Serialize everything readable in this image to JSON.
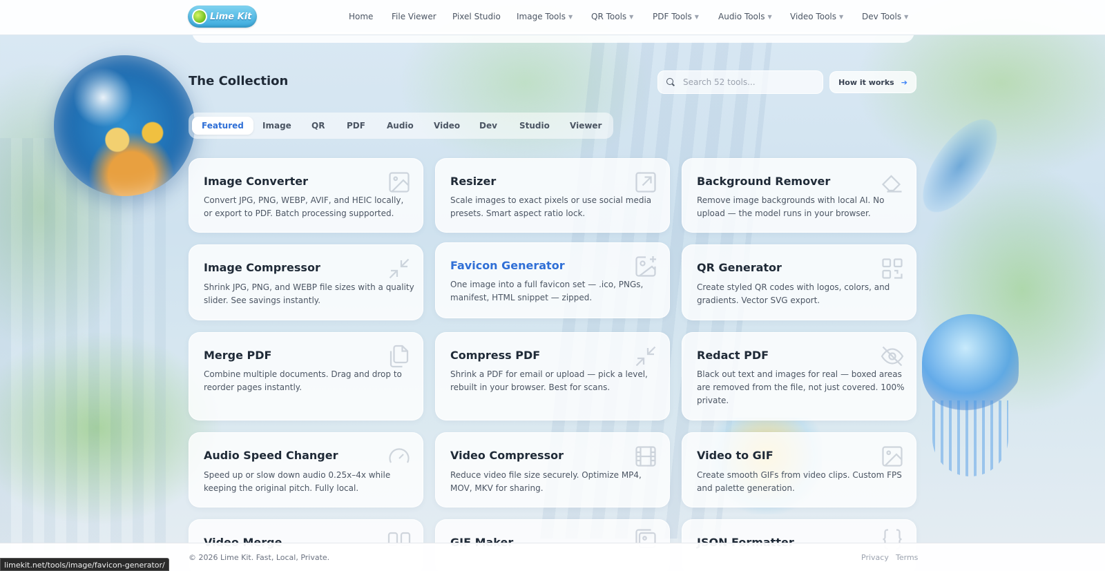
{
  "brand": {
    "logo_text": "Lime Kit"
  },
  "nav": {
    "items": [
      {
        "label": "Home",
        "dropdown": false
      },
      {
        "label": "File Viewer",
        "dropdown": false
      },
      {
        "label": "Pixel Studio",
        "dropdown": false
      },
      {
        "label": "Image Tools",
        "dropdown": true
      },
      {
        "label": "QR Tools",
        "dropdown": true
      },
      {
        "label": "PDF Tools",
        "dropdown": true
      },
      {
        "label": "Audio Tools",
        "dropdown": true
      },
      {
        "label": "Video Tools",
        "dropdown": true
      },
      {
        "label": "Dev Tools",
        "dropdown": true
      }
    ]
  },
  "collection": {
    "title": "The Collection",
    "search_placeholder": "Search 52 tools...",
    "how_label": "How it works"
  },
  "tabs": [
    {
      "label": "Featured",
      "active": true
    },
    {
      "label": "Image",
      "active": false
    },
    {
      "label": "QR",
      "active": false
    },
    {
      "label": "PDF",
      "active": false
    },
    {
      "label": "Audio",
      "active": false
    },
    {
      "label": "Video",
      "active": false
    },
    {
      "label": "Dev",
      "active": false
    },
    {
      "label": "Studio",
      "active": false
    },
    {
      "label": "Viewer",
      "active": false
    }
  ],
  "cards": [
    {
      "title": "Image Converter",
      "desc": "Convert JPG, PNG, WEBP, AVIF, and HEIC locally, or export to PDF. Batch processing supported.",
      "icon": "image-icon"
    },
    {
      "title": "Resizer",
      "desc": "Scale images to exact pixels or use social media presets. Smart aspect ratio lock.",
      "icon": "resize-icon"
    },
    {
      "title": "Background Remover",
      "desc": "Remove image backgrounds with local AI. No upload — the model runs in your browser.",
      "icon": "eraser-icon"
    },
    {
      "title": "Image Compressor",
      "desc": "Shrink JPG, PNG, and WEBP file sizes with a quality slider. See savings instantly.",
      "icon": "minimize-icon"
    },
    {
      "title": "Favicon Generator",
      "desc": "One image into a full favicon set — .ico, PNGs, manifest, HTML snippet — zipped.",
      "icon": "image-plus-icon",
      "hover": true
    },
    {
      "title": "QR Generator",
      "desc": "Create styled QR codes with logos, colors, and gradients. Vector SVG export.",
      "icon": "qr-code-icon"
    },
    {
      "title": "Merge PDF",
      "desc": "Combine multiple documents. Drag and drop to reorder pages instantly.",
      "icon": "files-icon"
    },
    {
      "title": "Compress PDF",
      "desc": "Shrink a PDF for email or upload — pick a level, rebuilt in your browser. Best for scans.",
      "icon": "minimize-icon"
    },
    {
      "title": "Redact PDF",
      "desc": "Black out text and images for real — boxed areas are removed from the file, not just covered. 100% private.",
      "icon": "eye-off-icon"
    },
    {
      "title": "Audio Speed Changer",
      "desc": "Speed up or slow down audio 0.25x–4x while keeping the original pitch. Fully local.",
      "icon": "gauge-icon"
    },
    {
      "title": "Video Compressor",
      "desc": "Reduce video file size securely. Optimize MP4, MOV, MKV for sharing.",
      "icon": "film-icon"
    },
    {
      "title": "Video to GIF",
      "desc": "Create smooth GIFs from video clips. Custom FPS and palette generation.",
      "icon": "image-icon"
    },
    {
      "title": "Video Merge",
      "desc": "",
      "icon": "merge-icon"
    },
    {
      "title": "GIF Maker",
      "desc": "",
      "icon": "images-icon"
    },
    {
      "title": "JSON Formatter",
      "desc": "",
      "icon": "braces-icon"
    }
  ],
  "footer": {
    "copyright": "© 2026 Lime Kit. Fast, Local, Private.",
    "privacy": "Privacy",
    "terms": "Terms"
  },
  "status_bar": {
    "url": "limekit.net/tools/image/favicon-generator/"
  }
}
